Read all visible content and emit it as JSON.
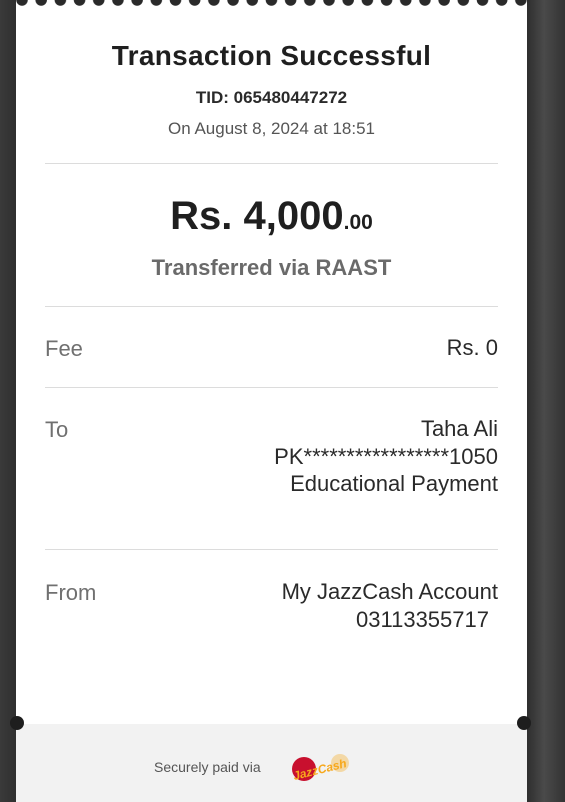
{
  "receipt": {
    "title": "Transaction Successful",
    "tid": "TID: 065480447272",
    "date": "On August 8, 2024 at 18:51",
    "amount_main": "Rs. 4,000",
    "amount_cents": ".00",
    "transfer_method": "Transferred via RAAST",
    "fee": {
      "label": "Fee",
      "value": "Rs. 0"
    },
    "to": {
      "label": "To",
      "name": "Taha Ali",
      "account": "PK*****************1050",
      "purpose": "Educational Payment"
    },
    "from": {
      "label": "From",
      "account_name": "My JazzCash Account",
      "number": "03113355717"
    },
    "footer": {
      "secure_text": "Securely paid via",
      "logo_text": "JazzCash",
      "logo_color_red": "#c8102e",
      "logo_color_orange": "#f7a81b"
    }
  }
}
